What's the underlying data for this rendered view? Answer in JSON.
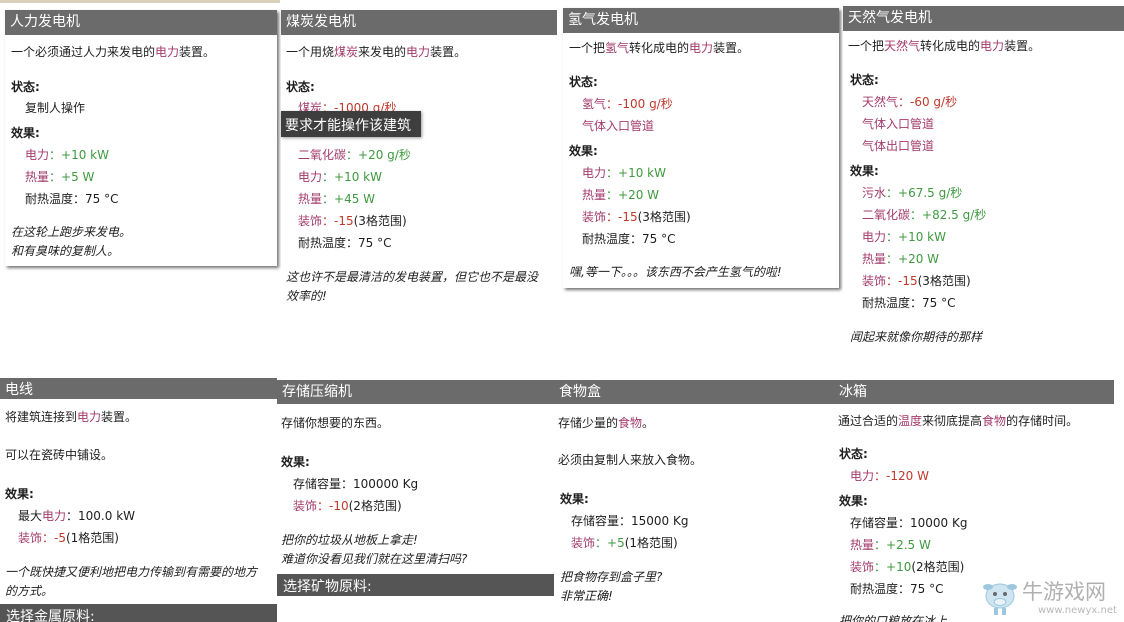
{
  "cards": {
    "manual": {
      "title": "人力发电机",
      "desc_pre": "一个必须通过人力来发电的",
      "desc_kw": "电力",
      "desc_post": "装置。",
      "status_label": "状态:",
      "status_value": "复制人操作",
      "effects_label": "效果:",
      "power_k": "电力",
      "power_v": "：+10 kW",
      "heat_k": "热量",
      "heat_v": "：+5 W",
      "temp": "耐热温度：75 °C",
      "flavor1": "在这轮上跑步来发电。",
      "flavor2": "和有臭味的复制人。"
    },
    "coal": {
      "title": "煤炭发电机",
      "desc_pre": "一个用烧",
      "desc_kw1": "煤炭",
      "desc_mid": "来发电的",
      "desc_kw2": "电力",
      "desc_post": "装置。",
      "status_label": "状态:",
      "coal_k": "煤炭",
      "coal_v": "：-1000 g/秒",
      "co2_k": "二氧化碳",
      "co2_v": "：+20 g/秒",
      "power_k": "电力",
      "power_v": "：+10 kW",
      "heat_k": "热量",
      "heat_v": "：+45 W",
      "deco_k": "装饰",
      "deco_v1": "：-15",
      "deco_v2": "(3格范围)",
      "temp": "耐热温度：75 °C",
      "flavor1": "这也许不是最清洁的发电装置，但它也不是最没",
      "flavor2": "效率的!",
      "tooltip": "要求才能操作该建筑"
    },
    "hydrogen": {
      "title": "氢气发电机",
      "desc_pre": "一个把",
      "desc_kw1": "氢气",
      "desc_mid": "转化成电的",
      "desc_kw2": "电力",
      "desc_post": "装置。",
      "status_label": "状态:",
      "h2_k": "氢气",
      "h2_v": "：-100 g/秒",
      "pipe_in": "气体入口管道",
      "effects_label": "效果:",
      "power_k": "电力",
      "power_v": "：+10 kW",
      "heat_k": "热量",
      "heat_v": "：+20 W",
      "deco_k": "装饰",
      "deco_v1": "：-15",
      "deco_v2": "(3格范围)",
      "temp": "耐热温度：75 °C",
      "flavor1": "嘿,等一下。。。该东西不会产生氢气的啦!"
    },
    "natgas": {
      "title": "天然气发电机",
      "desc_pre": "一个把",
      "desc_kw1": "天然气",
      "desc_mid": "转化成电的",
      "desc_kw2": "电力",
      "desc_post": "装置。",
      "status_label": "状态:",
      "gas_k": "天然气",
      "gas_v": "：-60 g/秒",
      "pipe_in": "气体入口管道",
      "pipe_out": "气体出口管道",
      "effects_label": "效果:",
      "water_k": "污水",
      "water_v": "：+67.5 g/秒",
      "co2_k": "二氧化碳",
      "co2_v": "：+82.5 g/秒",
      "power_k": "电力",
      "power_v": "：+10 kW",
      "heat_k": "热量",
      "heat_v": "：+20 W",
      "deco_k": "装饰",
      "deco_v1": "：-15",
      "deco_v2": "(3格范围)",
      "temp": "耐热温度：75 °C",
      "flavor1": "闻起来就像你期待的那样"
    },
    "wire": {
      "title": "电线",
      "desc_pre": "将建筑连接到",
      "desc_kw": "电力",
      "desc_post": "装置。",
      "desc2": "可以在瓷砖中铺设。",
      "effects_label": "效果:",
      "maxp_pre": "最大",
      "maxp_k": "电力",
      "maxp_v": "：100.0 kW",
      "deco_k": "装饰",
      "deco_v1": "：-5",
      "deco_v2": "(1格范围)",
      "flavor1": "一个既快捷又便利地把电力传输到有需要的地方",
      "flavor2": "的方式。",
      "bar": "选择金属原料:"
    },
    "storage": {
      "title": "存储压缩机",
      "desc": "存储你想要的东西。",
      "effects_label": "效果:",
      "cap": "存储容量：100000 Kg",
      "deco_k": "装饰",
      "deco_v1": "：-10",
      "deco_v2": "(2格范围)",
      "flavor1": "把你的垃圾从地板上拿走!",
      "flavor2": "难道你没看见我们就在这里清扫吗?",
      "bar": "选择矿物原料:"
    },
    "ration": {
      "title": "食物盒",
      "desc_pre": "存储少量的",
      "desc_kw": "食物",
      "desc_post": "。",
      "desc2": "必须由复制人来放入食物。",
      "effects_label": "效果:",
      "cap": "存储容量：15000 Kg",
      "deco_k": "装饰",
      "deco_v1": "：+5",
      "deco_v2": "(1格范围)",
      "flavor1": "把食物存到盒子里?",
      "flavor2": "非常正确!"
    },
    "fridge": {
      "title": "冰箱",
      "desc_pre": "通过合适的",
      "desc_kw1": "温度",
      "desc_mid": "来彻底提高",
      "desc_kw2": "食物",
      "desc_post": "的存储时间。",
      "status_label": "状态:",
      "power_k": "电力",
      "power_v": "：-120 W",
      "effects_label": "效果:",
      "cap": "存储容量：10000 Kg",
      "heat_k": "热量",
      "heat_v": "：+2.5 W",
      "deco_k": "装饰",
      "deco_v1": "：+10",
      "deco_v2": "(2格范围)",
      "temp": "耐热温度：75 °C",
      "flavor1": "把你的口粮放在冰上"
    }
  },
  "watermark": {
    "text": "牛游戏网",
    "url": "www.newyx.net"
  },
  "colors": {
    "header": "#6b6b6b",
    "keyword": "#a23b6b",
    "positive": "#3f9a3f",
    "negative": "#c0392b"
  }
}
